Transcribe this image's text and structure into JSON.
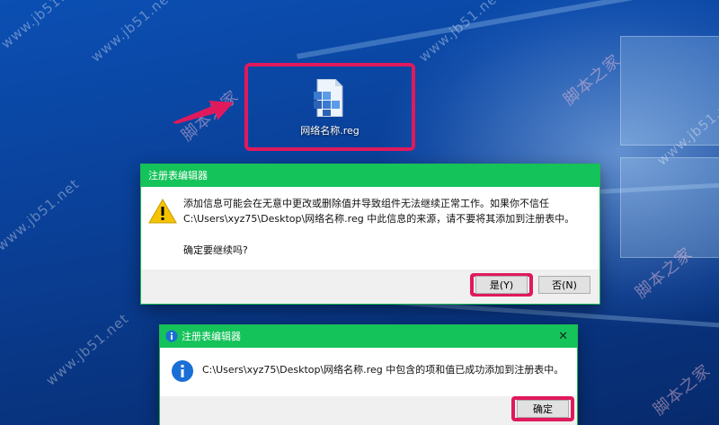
{
  "desktop": {
    "file_icon": {
      "name": "reg-file-icon",
      "label": "网络名称.reg"
    }
  },
  "watermarks": [
    "www.jb51.net",
    "脚本之家"
  ],
  "confirm_dialog": {
    "title": "注册表编辑器",
    "icon": "warning-icon",
    "message_line1": "添加信息可能会在无意中更改或删除值并导致组件无法继续正常工作。如果你不信任",
    "message_line2": "C:\\Users\\xyz75\\Desktop\\网络名称.reg 中此信息的来源，请不要将其添加到注册表中。",
    "question": "确定要继续吗?",
    "yes_label": "是(Y)",
    "no_label": "否(N)"
  },
  "result_dialog": {
    "title": "注册表编辑器",
    "title_icon": "info-icon",
    "close_glyph": "✕",
    "message": "C:\\Users\\xyz75\\Desktop\\网络名称.reg 中包含的项和值已成功添加到注册表中。",
    "ok_label": "确定"
  },
  "colors": {
    "highlight": "#e0195d",
    "titlebar": "#14c35a"
  }
}
